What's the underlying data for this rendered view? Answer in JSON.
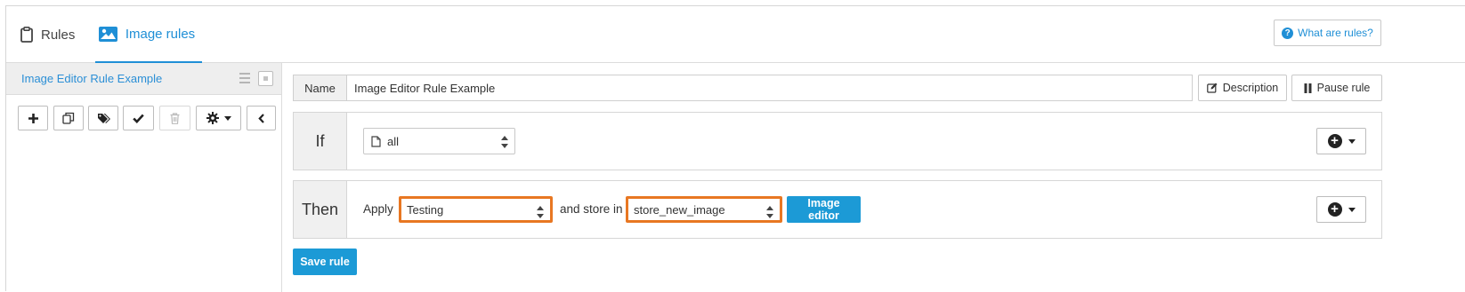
{
  "tabs": {
    "rules_label": "Rules",
    "image_rules_label": "Image rules",
    "active": "image_rules"
  },
  "help": {
    "label": "What are rules?"
  },
  "sidebar": {
    "rules": [
      {
        "label": "Image Editor Rule Example",
        "selected": true
      }
    ],
    "toolbar_icons": [
      "add-icon",
      "duplicate-icon",
      "tags-icon",
      "check-icon",
      "trash-icon",
      "gear-icon",
      "chevron-left-icon"
    ]
  },
  "rule": {
    "name_label": "Name",
    "name_value": "Image Editor Rule Example",
    "description_label": "Description",
    "pause_label": "Pause rule",
    "if": {
      "label": "If",
      "condition_value": "all"
    },
    "then": {
      "label": "Then",
      "apply_label": "Apply",
      "apply_value": "Testing",
      "store_label": "and store in",
      "store_value": "store_new_image",
      "image_editor_label": "Image editor"
    },
    "save_label": "Save rule"
  },
  "colors": {
    "accent": "#1f8fd6",
    "highlight": "#e87722",
    "primary_button": "#1c9ad6"
  }
}
